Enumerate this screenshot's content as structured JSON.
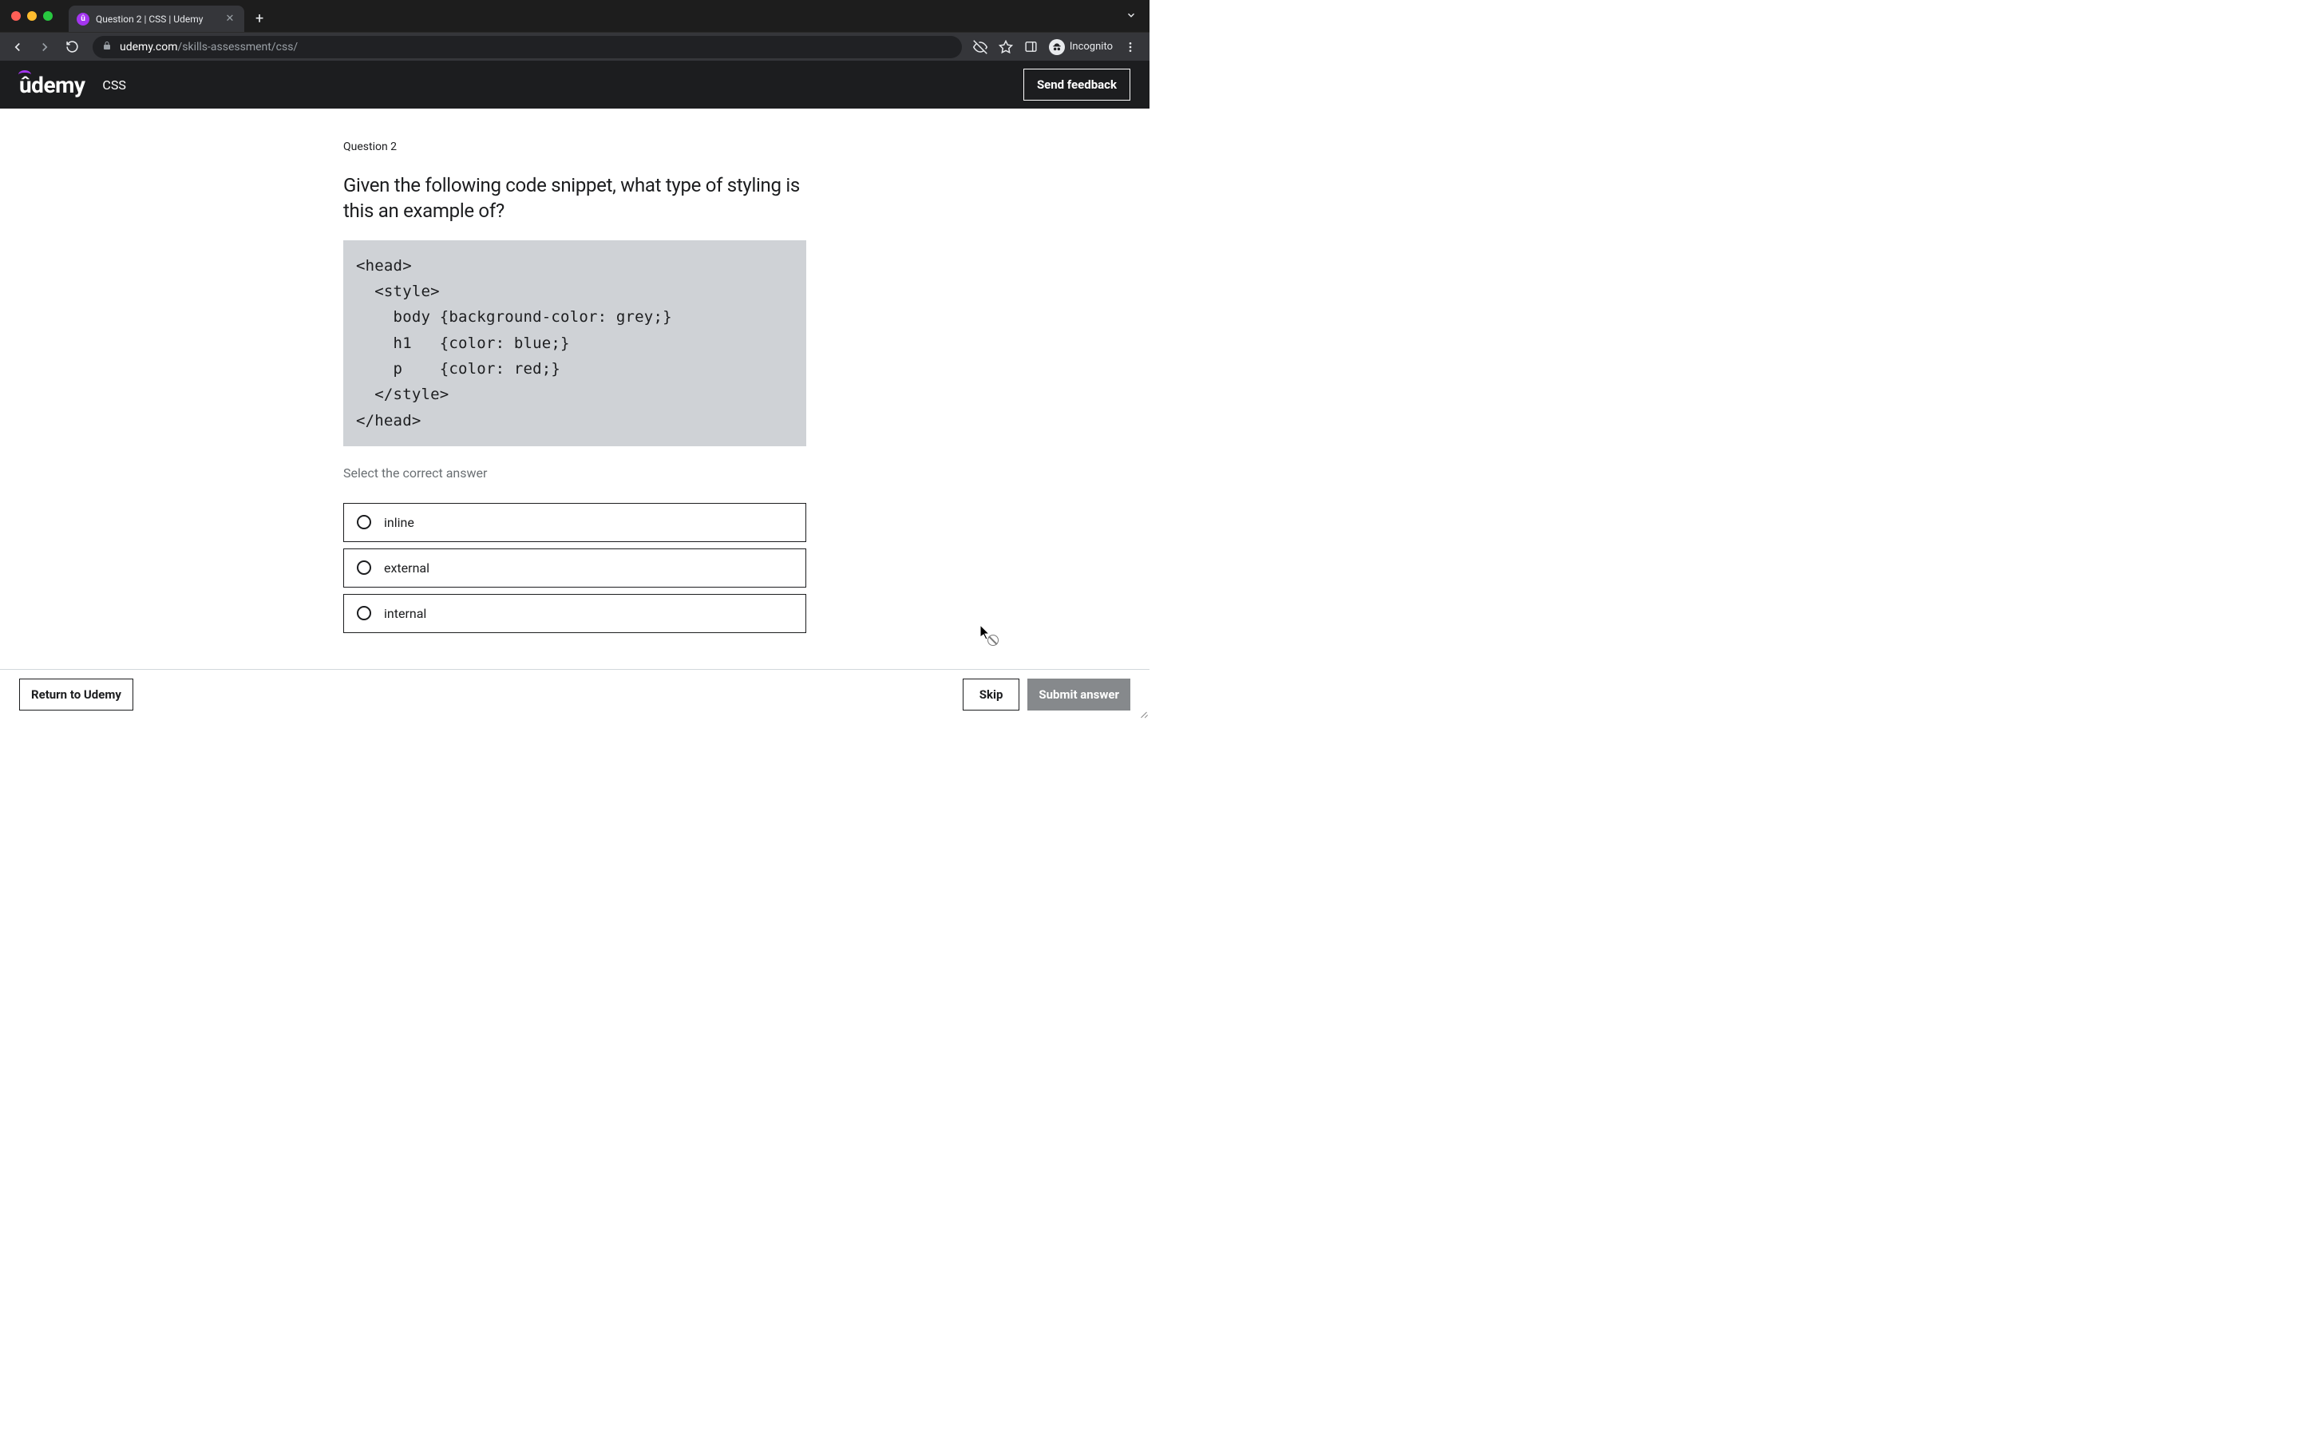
{
  "browser": {
    "tab_title": "Question 2 | CSS | Udemy",
    "url_domain": "udemy.com",
    "url_path": "/skills-assessment/css/",
    "incognito_label": "Incognito"
  },
  "header": {
    "logo_text": "ûdemy",
    "topic": "CSS",
    "feedback_label": "Send feedback"
  },
  "question": {
    "number_label": "Question 2",
    "prompt": "Given the following code snippet, what type of styling is this an example of?",
    "code": "<head>\n  <style>\n    body {background-color: grey;}\n    h1   {color: blue;}\n    p    {color: red;}\n  </style>\n</head>",
    "select_hint": "Select the correct answer",
    "options": [
      {
        "label": "inline"
      },
      {
        "label": "external"
      },
      {
        "label": "internal"
      }
    ]
  },
  "footer": {
    "return_label": "Return to Udemy",
    "skip_label": "Skip",
    "submit_label": "Submit answer"
  }
}
